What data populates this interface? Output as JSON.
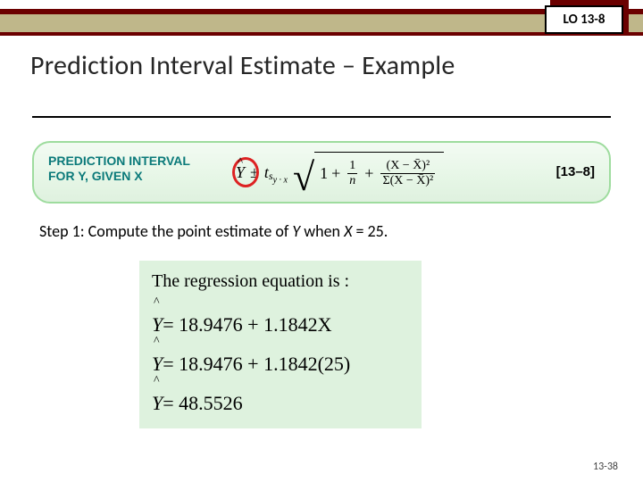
{
  "lo_badge": "LO 13-8",
  "title": "Prediction Interval Estimate – Example",
  "formula": {
    "label_line1": "PREDICTION INTERVAL",
    "label_line2": "FOR Y, GIVEN X",
    "ref": "[13–8]",
    "yhat": "Ŷ",
    "pm": "±",
    "t": "t",
    "s_sub": "y · x",
    "one": "1",
    "plus1": "+",
    "frac1_n": "1",
    "frac1_d": "n",
    "plus2": "+",
    "frac2_n": "(X − X̄)²",
    "frac2_d": "Σ(X − X̄)²"
  },
  "step1_prefix": "Step 1: Compute the point estimate of ",
  "step1_yvar": "Y",
  "step1_mid": " when ",
  "step1_xvar": "X",
  "step1_eq": " = 25.",
  "calc": {
    "heading": "The regression equation is :",
    "lines": [
      {
        "y": "Y",
        "rhs": " = 18.9476 + 1.1842X"
      },
      {
        "y": "Y",
        "rhs": " = 18.9476 + 1.1842(25)"
      },
      {
        "y": "Y",
        "rhs": " = 48.5526"
      }
    ],
    "intercept": 18.9476,
    "slope": 1.1842,
    "x_value": 25,
    "y_hat": 48.5526
  },
  "page_number": "13-38",
  "chart_data": null
}
